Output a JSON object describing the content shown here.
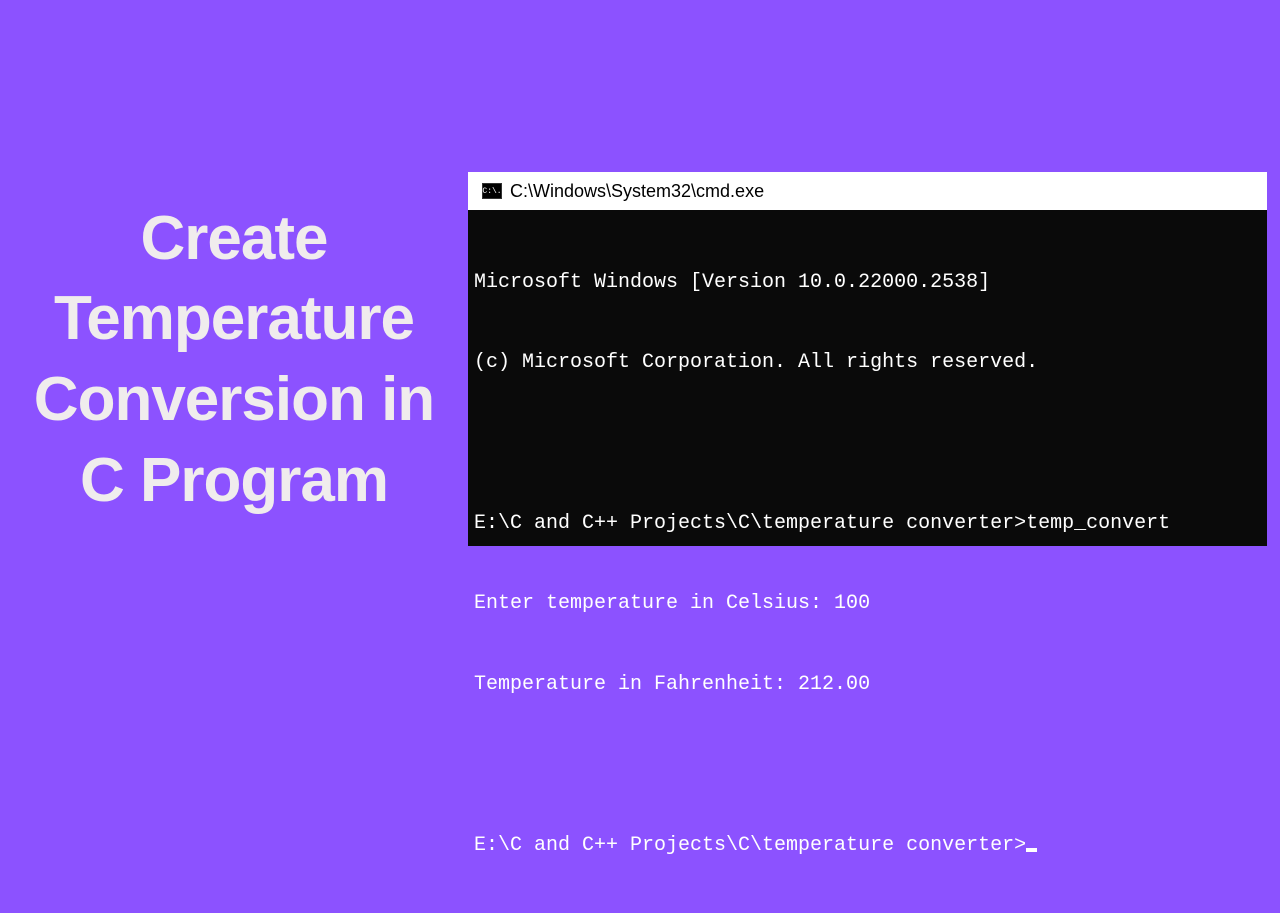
{
  "title": "Create Temperature Conversion in C Program",
  "window": {
    "icon_label": "C:\\.",
    "title": "C:\\Windows\\System32\\cmd.exe"
  },
  "terminal": {
    "line1": "Microsoft Windows [Version 10.0.22000.2538]",
    "line2": "(c) Microsoft Corporation. All rights reserved.",
    "line3": "E:\\C and C++ Projects\\C\\temperature converter>temp_convert",
    "line4": "Enter temperature in Celsius: 100",
    "line5": "Temperature in Fahrenheit: 212.00",
    "line6": "E:\\C and C++ Projects\\C\\temperature converter>"
  }
}
